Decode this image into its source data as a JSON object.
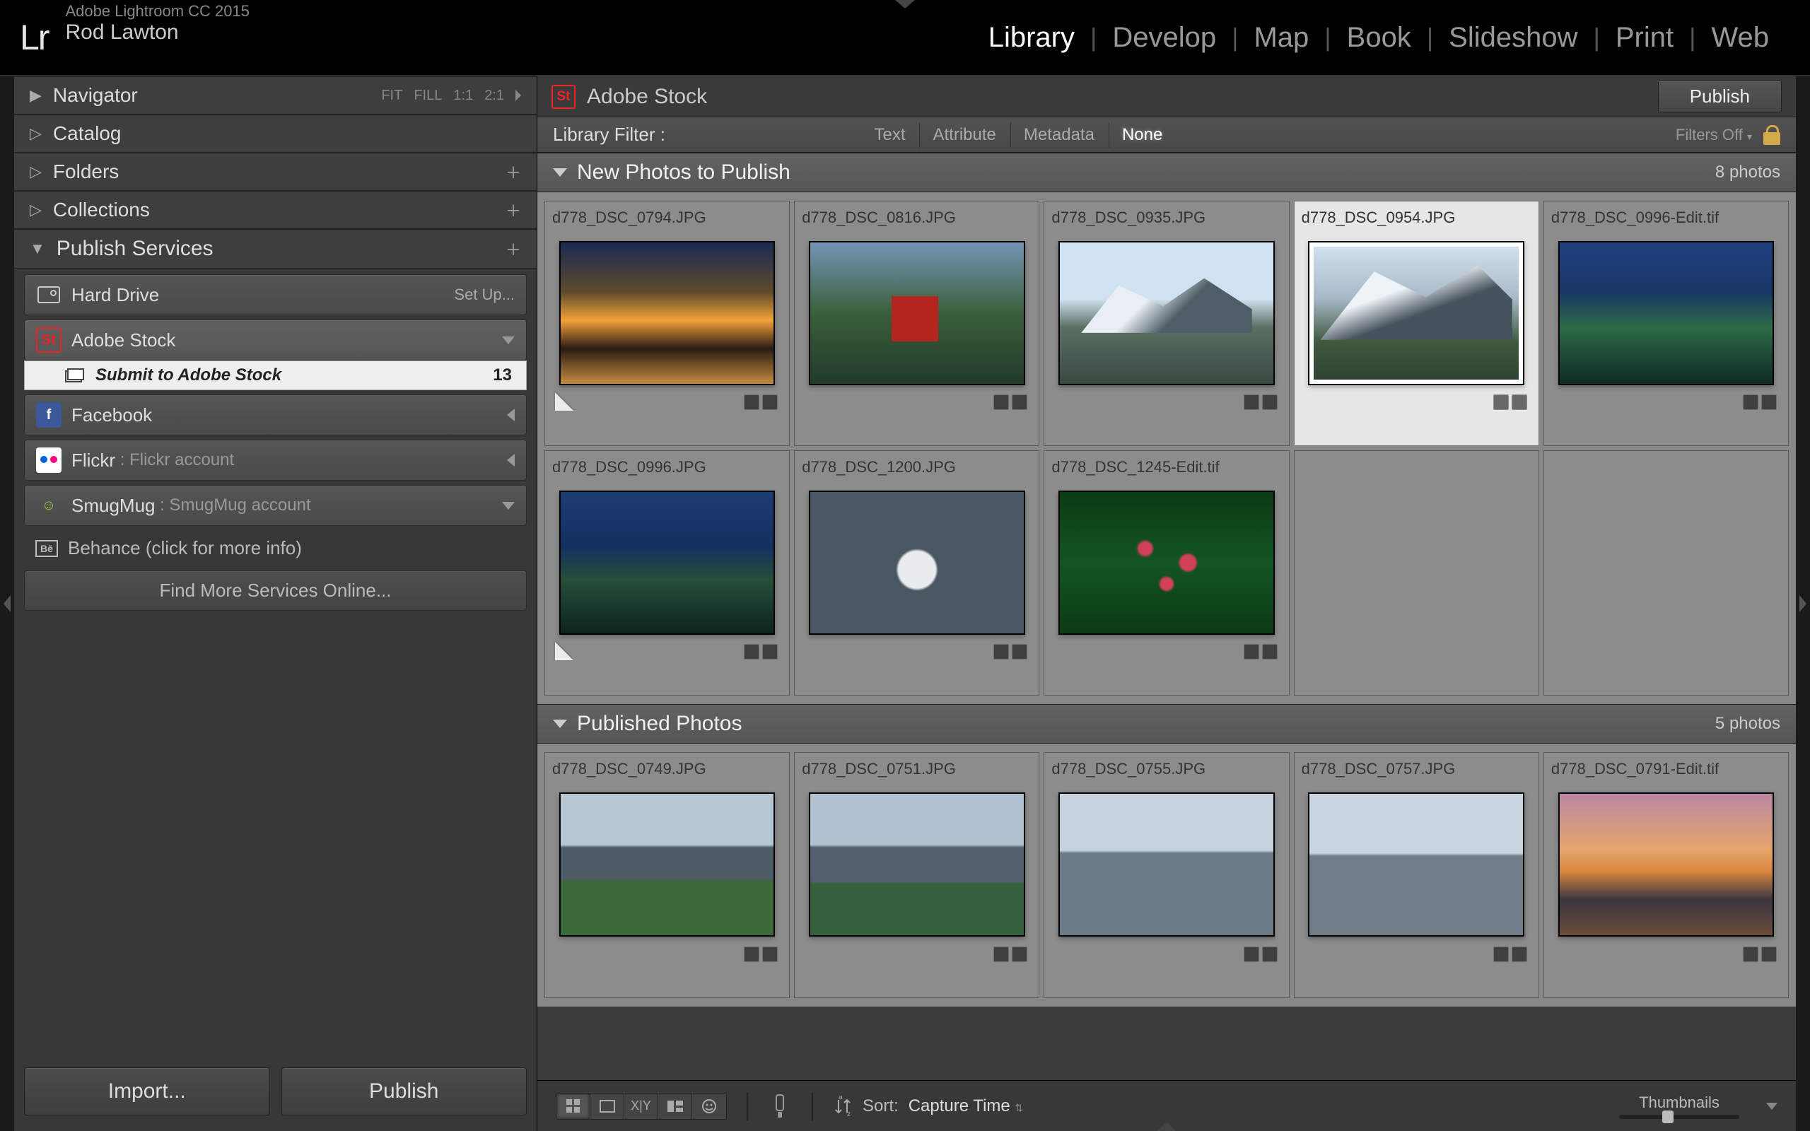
{
  "app": {
    "suite": "Lr",
    "product": "Adobe Lightroom CC 2015",
    "user": "Rod Lawton"
  },
  "nav": {
    "items": [
      "Library",
      "Develop",
      "Map",
      "Book",
      "Slideshow",
      "Print",
      "Web"
    ],
    "active": "Library"
  },
  "navigator": {
    "title": "Navigator",
    "modes": [
      "FIT",
      "FILL",
      "1:1",
      "2:1"
    ]
  },
  "leftPanels": {
    "catalog": "Catalog",
    "folders": "Folders",
    "collections": "Collections"
  },
  "publish": {
    "title": "Publish Services",
    "hardDrive": {
      "label": "Hard Drive",
      "action": "Set Up..."
    },
    "adobeStock": {
      "label": "Adobe Stock",
      "sub": "Submit to Adobe Stock",
      "count": "13"
    },
    "facebook": {
      "label": "Facebook"
    },
    "flickr": {
      "label": "Flickr",
      "account": "Flickr account"
    },
    "smugmug": {
      "label": "SmugMug",
      "account": "SmugMug account"
    },
    "behance": {
      "label": "Behance (click for more info)"
    },
    "findMore": "Find More Services Online..."
  },
  "leftButtons": {
    "import": "Import...",
    "publish": "Publish"
  },
  "mainHeader": {
    "title": "Adobe Stock",
    "publish": "Publish"
  },
  "filter": {
    "label": "Library Filter :",
    "options": [
      "Text",
      "Attribute",
      "Metadata",
      "None"
    ],
    "active": "None",
    "right": "Filters Off"
  },
  "sections": {
    "new": {
      "title": "New Photos to Publish",
      "count": "8 photos"
    },
    "published": {
      "title": "Published Photos",
      "count": "5 photos"
    }
  },
  "newPhotos": [
    {
      "fn": "d778_DSC_0794.JPG",
      "cls": "sunset",
      "fold": true
    },
    {
      "fn": "d778_DSC_0816.JPG",
      "cls": "redhouse"
    },
    {
      "fn": "d778_DSC_0935.JPG",
      "cls": "mountain1"
    },
    {
      "fn": "d778_DSC_0954.JPG",
      "cls": "mountain2",
      "selected": true
    },
    {
      "fn": "d778_DSC_0996-Edit.tif",
      "cls": "fjord1"
    },
    {
      "fn": "d778_DSC_0996.JPG",
      "cls": "fjord2",
      "fold": true
    },
    {
      "fn": "d778_DSC_1200.JPG",
      "cls": "boat"
    },
    {
      "fn": "d778_DSC_1245-Edit.tif",
      "cls": "flowers"
    }
  ],
  "publishedPhotos": [
    {
      "fn": "d778_DSC_0749.JPG",
      "cls": "town1"
    },
    {
      "fn": "d778_DSC_0751.JPG",
      "cls": "town2"
    },
    {
      "fn": "d778_DSC_0755.JPG",
      "cls": "town3"
    },
    {
      "fn": "d778_DSC_0757.JPG",
      "cls": "town4"
    },
    {
      "fn": "d778_DSC_0791-Edit.tif",
      "cls": "dusk"
    }
  ],
  "toolbar": {
    "sortLabel": "Sort:",
    "sortValue": "Capture Time",
    "thumbLabel": "Thumbnails"
  }
}
